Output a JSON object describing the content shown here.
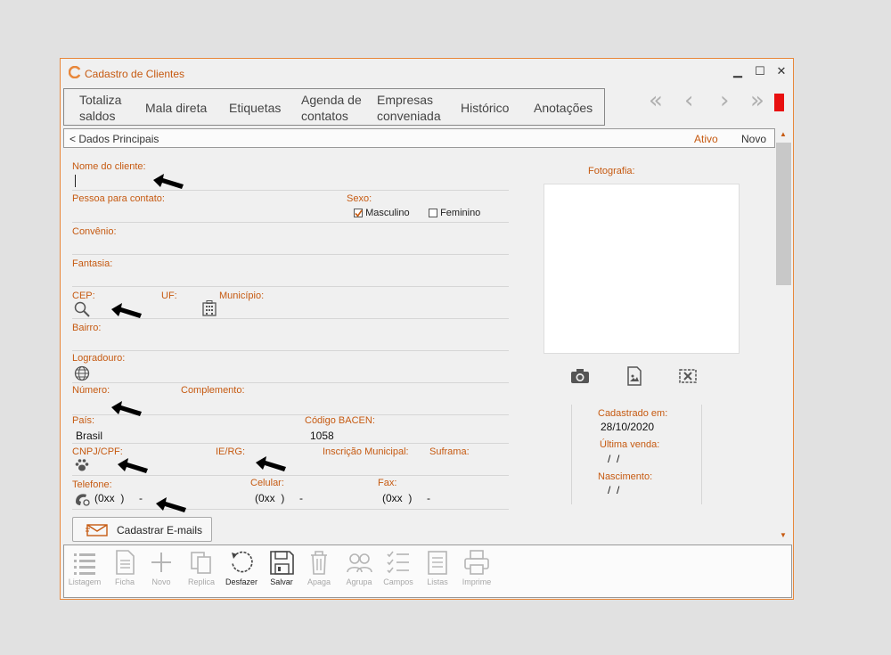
{
  "window": {
    "title": "Cadastro de Clientes",
    "minimize": "▁",
    "maximize": "☐",
    "close": "✕"
  },
  "menu": [
    {
      "line1": "Totaliza",
      "line2": "saldos"
    },
    {
      "line1": "Mala direta",
      "line2": ""
    },
    {
      "line1": "Etiquetas",
      "line2": ""
    },
    {
      "line1": "Agenda de",
      "line2": "contatos"
    },
    {
      "line1": "Empresas",
      "line2": "conveniada"
    },
    {
      "line1": "Histórico",
      "line2": ""
    },
    {
      "line1": "Anotações",
      "line2": ""
    }
  ],
  "section": {
    "title": "< Dados Principais",
    "status": "Ativo",
    "new_label": "Novo"
  },
  "form": {
    "nome_label": "Nome do cliente:",
    "contato_label": "Pessoa para contato:",
    "sexo_label": "Sexo:",
    "masculino": "Masculino",
    "feminino": "Feminino",
    "masculino_checked": true,
    "feminino_checked": false,
    "convenio_label": "Convênio:",
    "fantasia_label": "Fantasia:",
    "cep_label": "CEP:",
    "uf_label": "UF:",
    "municipio_label": "Município:",
    "bairro_label": "Bairro:",
    "logradouro_label": "Logradouro:",
    "numero_label": "Número:",
    "complemento_label": "Complemento:",
    "pais_label": "País:",
    "pais_value": "Brasil",
    "bacen_label": "Código BACEN:",
    "bacen_value": "1058",
    "cnpj_label": "CNPJ/CPF:",
    "ie_label": "IE/RG:",
    "inscricao_label": "Inscrição Municipal:",
    "suframa_label": "Suframa:",
    "telefone_label": "Telefone:",
    "telefone_value": "(0xx  )     -",
    "celular_label": "Celular:",
    "celular_value": "(0xx  )     -",
    "fax_label": "Fax:",
    "fax_value": "(0xx  )     -"
  },
  "photo": {
    "label": "Fotografia:"
  },
  "info": {
    "cadastrado_label": "Cadastrado em:",
    "cadastrado_value": "28/10/2020",
    "ultima_label": "Última venda:",
    "ultima_value": "/  /",
    "nascimento_label": "Nascimento:",
    "nascimento_value": "/  /"
  },
  "email_button": "Cadastrar E-mails",
  "toolbar": [
    {
      "label": "Listagem",
      "enabled": false
    },
    {
      "label": "Ficha",
      "enabled": false
    },
    {
      "label": "Novo",
      "enabled": false
    },
    {
      "label": "Replica",
      "enabled": false
    },
    {
      "label": "Desfazer",
      "enabled": true
    },
    {
      "label": "Salvar",
      "enabled": true
    },
    {
      "label": "Apaga",
      "enabled": false
    },
    {
      "label": "Agrupa",
      "enabled": false
    },
    {
      "label": "Campos",
      "enabled": false
    },
    {
      "label": "Listas",
      "enabled": false
    },
    {
      "label": "Imprime",
      "enabled": false
    }
  ],
  "colors": {
    "accent": "#c65a11",
    "border": "#e8873a",
    "red_indicator": "#e81010"
  }
}
